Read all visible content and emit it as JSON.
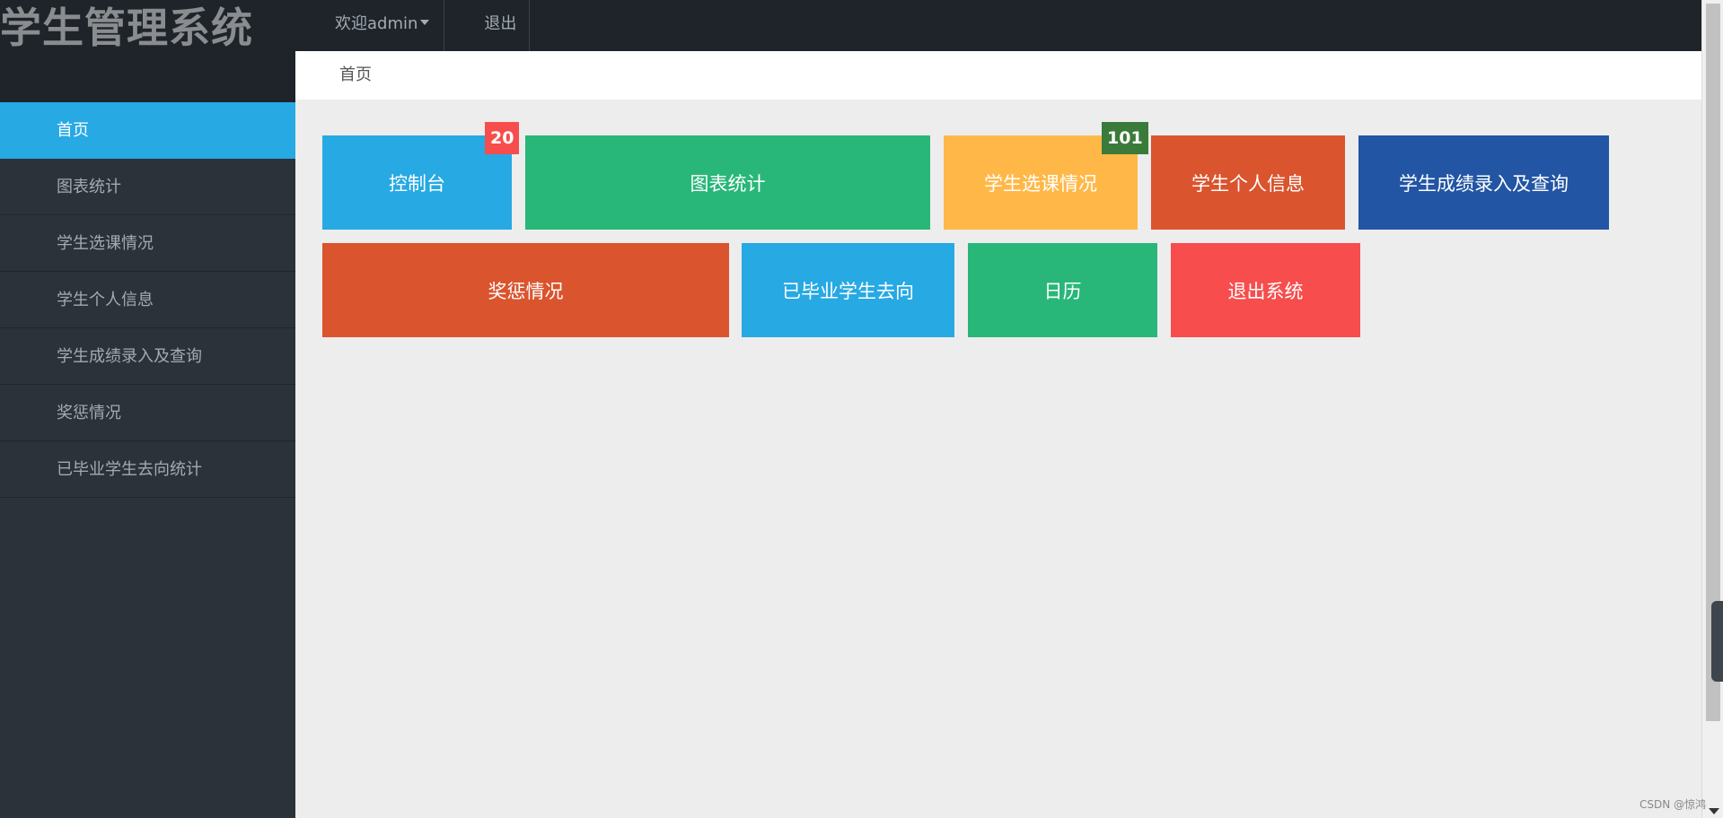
{
  "brand": {
    "title": "学生管理系统"
  },
  "topbar": {
    "welcome": "欢迎admin",
    "logout": "退出"
  },
  "breadcrumb": {
    "current": "首页"
  },
  "sidebar": {
    "items": [
      {
        "label": "首页",
        "active": true
      },
      {
        "label": "图表统计"
      },
      {
        "label": "学生选课情况"
      },
      {
        "label": "学生个人信息"
      },
      {
        "label": "学生成绩录入及查询"
      },
      {
        "label": "奖惩情况"
      },
      {
        "label": "已毕业学生去向统计"
      }
    ]
  },
  "tiles": [
    {
      "label": "控制台",
      "color": "#27a9e3",
      "badge": "20",
      "badge_color": "#f74d4d"
    },
    {
      "label": "图表统计",
      "color": "#28b779"
    },
    {
      "label": "学生选课情况",
      "color": "#ffb848",
      "badge": "101",
      "badge_color": "#3a7b3a"
    },
    {
      "label": "学生个人信息",
      "color": "#da542e"
    },
    {
      "label": "学生成绩录入及查询",
      "color": "#2255a4"
    },
    {
      "label": "奖惩情况",
      "color": "#da542e"
    },
    {
      "label": "已毕业学生去向",
      "color": "#27a9e3"
    },
    {
      "label": "日历",
      "color": "#28b779"
    },
    {
      "label": "退出系统",
      "color": "#f74d4d"
    }
  ],
  "watermark": "CSDN @惊鸿"
}
